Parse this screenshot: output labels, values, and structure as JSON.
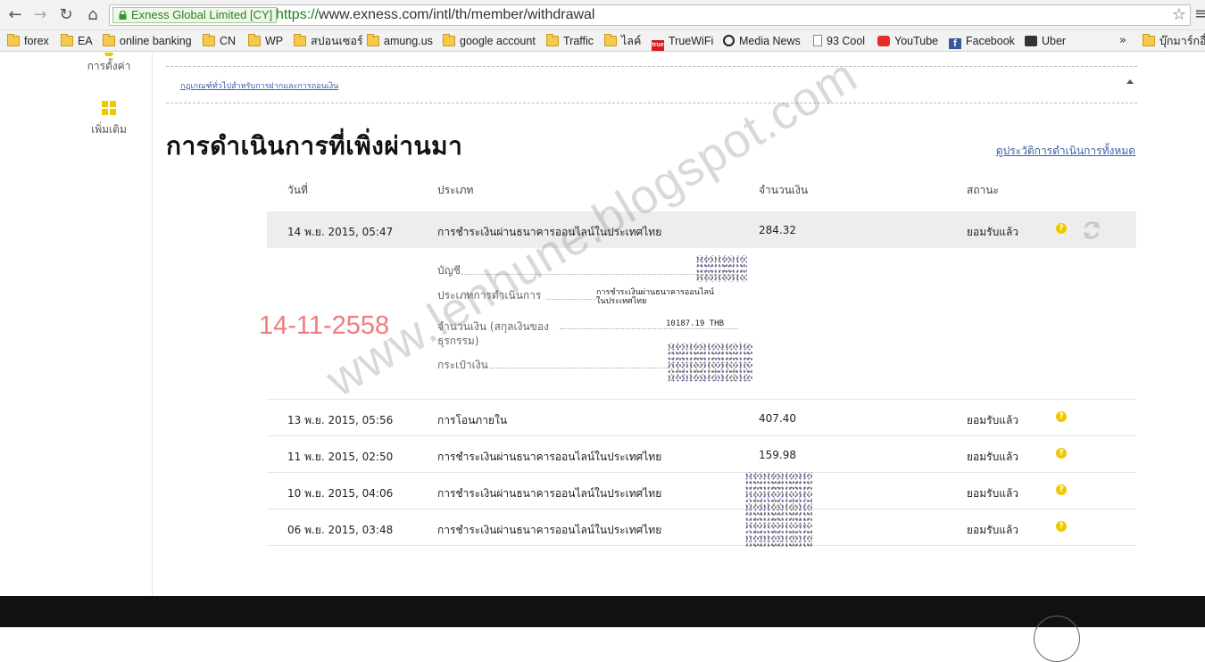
{
  "browser": {
    "ev_label": "Exness Global Limited [CY]",
    "url_protocol": "https://",
    "url_rest": "www.exness.com/intl/th/member/withdrawal",
    "back_icon": "back-arrow-icon",
    "forward_icon": "forward-arrow-icon",
    "reload_icon": "reload-icon",
    "home_icon": "home-icon",
    "bookmarks": [
      {
        "label": "forex"
      },
      {
        "label": "EA"
      },
      {
        "label": "online banking"
      },
      {
        "label": "CN"
      },
      {
        "label": "WP"
      },
      {
        "label": "สปอนเซอร์"
      },
      {
        "label": "amung.us"
      },
      {
        "label": "google account"
      },
      {
        "label": "Traffic"
      },
      {
        "label": "ไลค์"
      },
      {
        "label": "TrueWiFi"
      },
      {
        "label": "Media News"
      },
      {
        "label": "93 Cool"
      },
      {
        "label": "YouTube"
      },
      {
        "label": "Facebook"
      },
      {
        "label": "Uber"
      },
      {
        "label": "บุ๊กมาร์กอื่น"
      }
    ],
    "more_chevron": "»"
  },
  "sidebar": {
    "settings_label": "การตั้งค่า",
    "more_label": "เพิ่มเติม"
  },
  "rules": {
    "link": "กฎเกณฑ์ทั่วไปสำหรับการฝากและการถอนเงิน"
  },
  "recent": {
    "title": "การดำเนินการที่เพิ่งผ่านมา",
    "history_link": "ดูประวัติการดำเนินการทั้งหมด",
    "headers": {
      "date": "วันที่",
      "type": "ประเภท",
      "amount": "จำนวนเงิน",
      "status": "สถานะ"
    },
    "rows": [
      {
        "date": "14 พ.ย. 2015, 05:47",
        "type": "การชำระเงินผ่านธนาคารออนไลน์ในประเทศไทย",
        "amount": "284.32",
        "status": "ยอมรับแล้ว"
      },
      {
        "date": "13 พ.ย. 2015, 05:56",
        "type": "การโอนภายใน",
        "amount": "407.40",
        "status": "ยอมรับแล้ว"
      },
      {
        "date": "11 พ.ย. 2015, 02:50",
        "type": "การชำระเงินผ่านธนาคารออนไลน์ในประเทศไทย",
        "amount": "159.98",
        "status": "ยอมรับแล้ว"
      },
      {
        "date": "10 พ.ย. 2015, 04:06",
        "type": "การชำระเงินผ่านธนาคารออนไลน์ในประเทศไทย",
        "amount": "",
        "status": "ยอมรับแล้ว"
      },
      {
        "date": "06 พ.ย. 2015, 03:48",
        "type": "การชำระเงินผ่านธนาคารออนไลน์ในประเทศไทย",
        "amount": "",
        "status": "ยอมรับแล้ว"
      }
    ],
    "details": {
      "account_label": "บัญชี",
      "op_type_label": "ประเภทการดำเนินการ",
      "op_type_value_1": "การชำระเงินผ่านธนาคารออนไลน์",
      "op_type_value_2": "ในประเทศไทย",
      "amount_label_1": "จำนวนเงิน (สกุลเงินของ",
      "amount_label_2": "ธุรกรรม)",
      "amount_value": "10187.19 THB",
      "wallet_label": "กระเป๋าเงิน"
    }
  },
  "annotations": {
    "date_stamp": "14-11-2558",
    "watermark": "www.lenhune.blogspot.com"
  },
  "colors": {
    "accent_yellow": "#f0c800",
    "link_blue": "#3a5fa8",
    "stamp_red": "#f07a7a"
  }
}
